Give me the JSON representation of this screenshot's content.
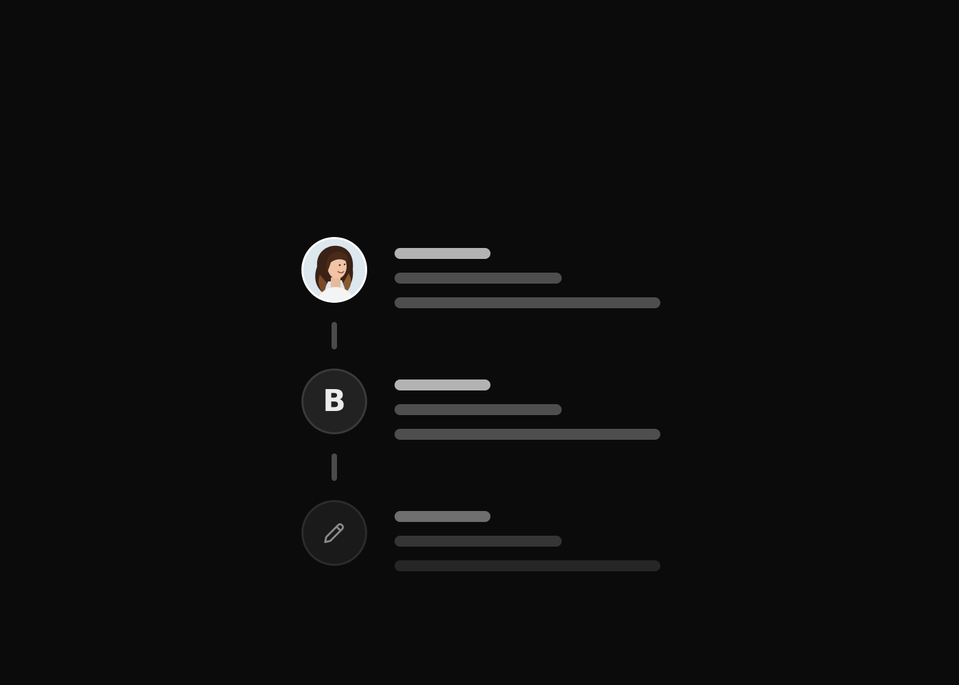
{
  "timeline": {
    "items": [
      {
        "avatar_type": "photo"
      },
      {
        "avatar_type": "letter",
        "avatar_letter": "B"
      },
      {
        "avatar_type": "icon",
        "icon": "pencil-icon"
      }
    ]
  },
  "colors": {
    "background": "#0b0b0b",
    "title_placeholder": "#b3b3b3",
    "line_placeholder": "#4e4e4e",
    "connector": "#4a4a4a"
  }
}
